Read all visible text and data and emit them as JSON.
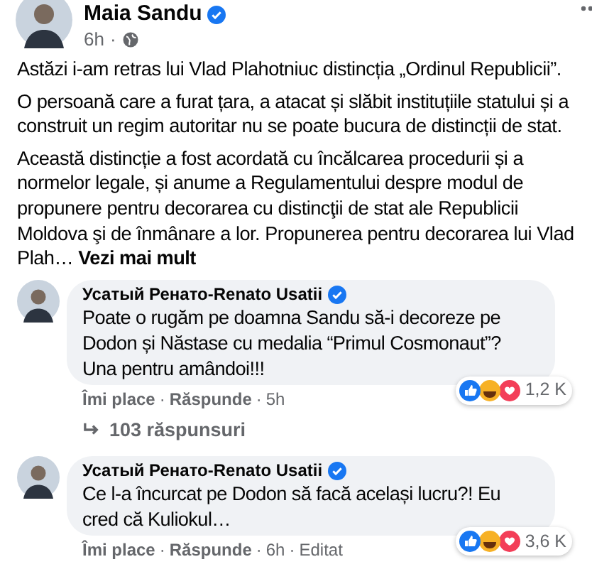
{
  "post": {
    "author": "Maia Sandu",
    "verified": true,
    "time": "6h",
    "separator": "·",
    "paragraphs": [
      "Astăzi i-am retras lui Vlad Plahotniuc distincția „Ordinul Republicii”.",
      "O persoană care a furat țara, a atacat și slăbit instituțiile statului și a construit un regim autoritar nu se poate bucura de distincții de stat.",
      "Această distincție a fost acordată cu încălcarea procedurii și a normelor legale, și anume a Regulamentului despre modul de propunere pentru decorarea cu distincţii de stat ale Republicii Moldova şi de înmânare a lor. Propunerea pentru decorarea lui Vlad Plah…"
    ],
    "see_more": "Vezi mai mult"
  },
  "comments": [
    {
      "author": "Усатый Ренато-Renato Usatii",
      "verified": true,
      "text": "Poate o rugăm pe doamna Sandu să-i decoreze pe Dodon și Năstase cu medalia “Primul Cosmonaut”? Una pentru amândoi!!!",
      "like": "Îmi place",
      "reply": "Răspunde",
      "time": "5h",
      "reaction_count": "1,2 K",
      "replies": "103 răspunsuri"
    },
    {
      "author": "Усатый Ренато-Renato Usatii",
      "verified": true,
      "text": "Ce l-a încurcat pe Dodon să facă același lucru?! Eu cred că Kuliokul…",
      "like": "Îmi place",
      "reply": "Răspunde",
      "time": "6h",
      "edited": "Editat",
      "reaction_count": "3,6 K"
    }
  ]
}
